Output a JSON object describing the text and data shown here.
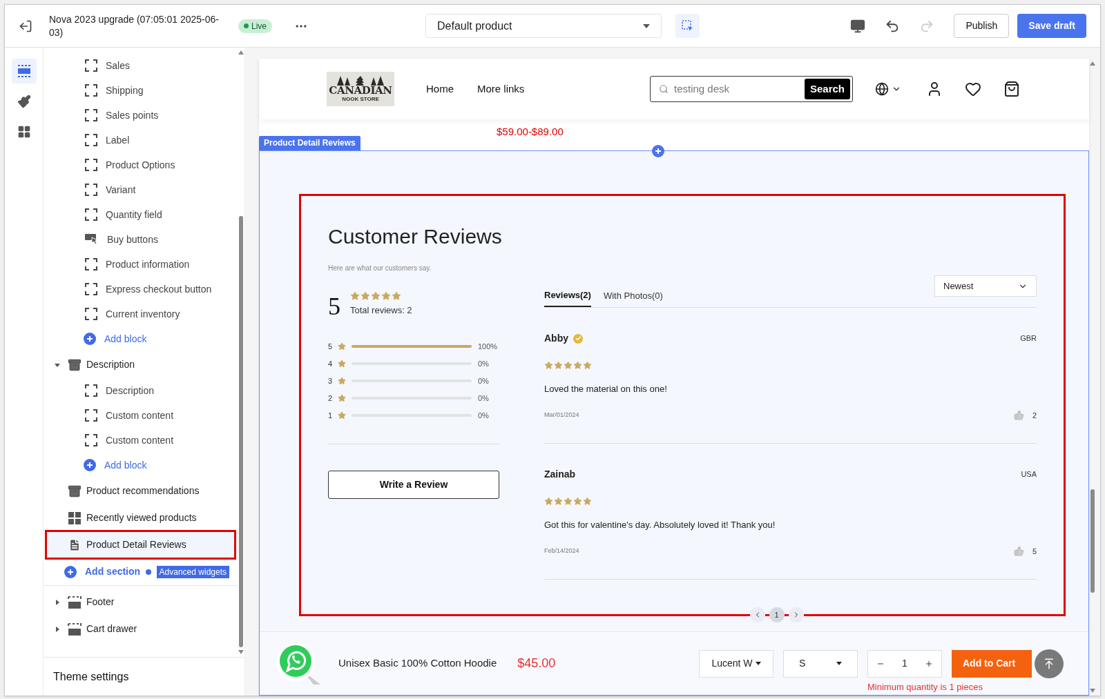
{
  "topbar": {
    "title": "Nova 2023 upgrade (07:05:01 2025-06-03)",
    "status": "Live",
    "page_select": "Default product",
    "publish": "Publish",
    "save": "Save draft"
  },
  "rail": [
    {
      "kind": "sections",
      "selected": true
    },
    {
      "kind": "theme",
      "selected": false
    },
    {
      "kind": "apps",
      "selected": false
    }
  ],
  "tree": [
    {
      "children": [
        {
          "kind": "block",
          "label": "Sales"
        },
        {
          "kind": "block",
          "label": "Shipping"
        },
        {
          "kind": "block",
          "label": "Sales points"
        },
        {
          "kind": "block",
          "label": "Label"
        },
        {
          "kind": "block",
          "label": "Product Options"
        },
        {
          "kind": "block",
          "label": "Variant"
        },
        {
          "kind": "block",
          "label": "Quantity field"
        },
        {
          "kind": "buy",
          "label": "Buy buttons"
        },
        {
          "kind": "block",
          "label": "Product information"
        },
        {
          "kind": "block",
          "label": "Express checkout button"
        },
        {
          "kind": "block",
          "label": "Current inventory"
        },
        {
          "kind": "add",
          "label": "Add block"
        }
      ]
    },
    {
      "kind": "section",
      "label": "Description",
      "expanded": true,
      "selected": false,
      "children": [
        {
          "kind": "block",
          "label": "Description"
        },
        {
          "kind": "block",
          "label": "Custom content"
        },
        {
          "kind": "block",
          "label": "Custom content"
        },
        {
          "kind": "add",
          "label": "Add block"
        }
      ]
    },
    {
      "kind": "section",
      "label": "Product recommendations",
      "selected": false
    },
    {
      "kind": "grid",
      "label": "Recently viewed products",
      "selected": false
    },
    {
      "kind": "page",
      "label": "Product Detail Reviews",
      "selected": true,
      "highlighted": true
    },
    {
      "kind": "add-section",
      "label": "Add section",
      "badge": "Advanced widgets"
    },
    {
      "kind": "frame",
      "label": "Footer",
      "expanded": false,
      "selected": false
    },
    {
      "kind": "frame",
      "label": "Cart drawer",
      "expanded": false,
      "selected": false
    }
  ],
  "theme_settings": "Theme settings",
  "store": {
    "logo_top": "CANADIAN",
    "logo_bottom": "NOOK STORE",
    "nav": [
      "Home",
      "More links"
    ],
    "search_value": "testing desk",
    "search_button": "Search",
    "price": "$59.00-$89.00"
  },
  "section_tag": "Product Detail Reviews",
  "reviews": {
    "highlighted": true,
    "title": "Customer Reviews",
    "subtitle": "Here are what our customers say.",
    "average": "5",
    "stars": 5,
    "total": "Total reviews: 2",
    "breakdown": [
      {
        "label": "5",
        "level": 1,
        "reading": "100%"
      },
      {
        "label": "4",
        "level": 0,
        "reading": "0%"
      },
      {
        "label": "3",
        "level": 0,
        "reading": "0%"
      },
      {
        "label": "2",
        "level": 0,
        "reading": "0%"
      },
      {
        "label": "1",
        "level": 0,
        "reading": "0%"
      }
    ],
    "write_button": "Write a Review",
    "tabs": [
      {
        "label": "Reviews(2)",
        "selected": true
      },
      {
        "label": "With Photos(0)",
        "selected": false
      }
    ],
    "sort": "Newest",
    "items": [
      {
        "name": "Abby",
        "verified": true,
        "country": "GBR",
        "stars": 5,
        "text": "Loved the material on this one!",
        "date": "Mar/01/2024",
        "likes": "2"
      },
      {
        "name": "Zainab",
        "verified": false,
        "country": "USA",
        "stars": 5,
        "text": "Got this for valentine's day. Absolutely loved it! Thank you!",
        "date": "Feb/14/2024",
        "likes": "5"
      }
    ],
    "pages": [
      {
        "label": "1",
        "selected": true
      }
    ]
  },
  "sticky": {
    "product": "Unisex Basic 100% Cotton Hoodie",
    "price": "$45.00",
    "variant": "Lucent W",
    "size": "S",
    "qty": "1",
    "add": "Add to Cart",
    "note": "Minimum quantity is 1 pieces"
  }
}
